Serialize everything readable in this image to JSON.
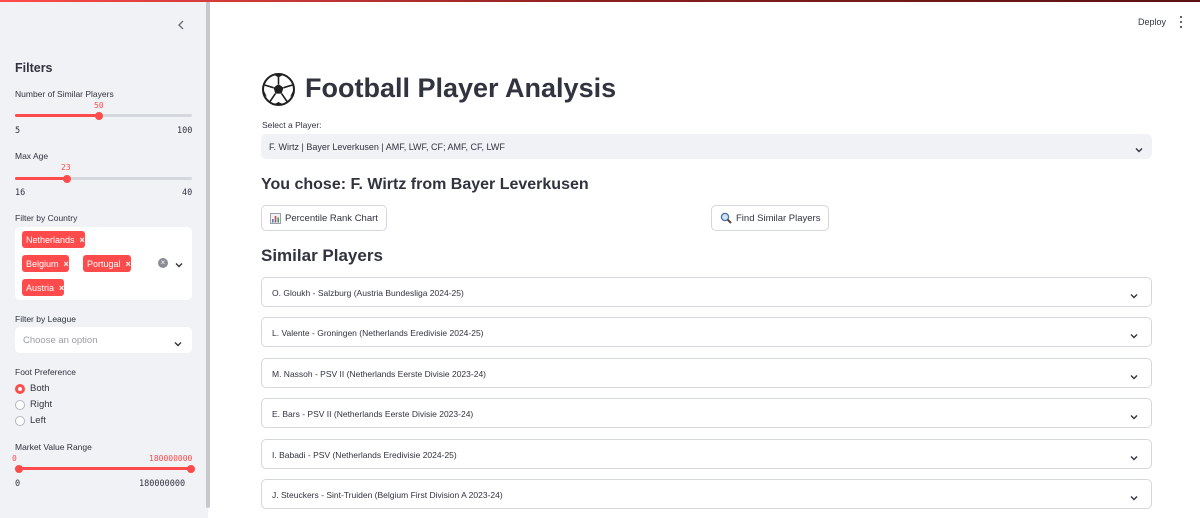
{
  "sidebar": {
    "heading": "Filters",
    "similar_players": {
      "label": "Number of Similar Players",
      "value": "50",
      "min": "5",
      "max": "100",
      "fraction": 0.4737
    },
    "max_age": {
      "label": "Max Age",
      "value": "23",
      "min": "16",
      "max": "40",
      "fraction": 0.2917
    },
    "country": {
      "label": "Filter by Country",
      "tags": [
        "Netherlands",
        "Belgium",
        "Portugal",
        "Austria"
      ]
    },
    "league": {
      "label": "Filter by League",
      "placeholder": "Choose an option"
    },
    "foot": {
      "label": "Foot Preference",
      "options": [
        "Both",
        "Right",
        "Left"
      ],
      "selected": "Both"
    },
    "market_value": {
      "label": "Market Value Range",
      "low": "0",
      "high": "180000000",
      "min": "0",
      "max": "180000000",
      "low_fraction": 0,
      "high_fraction": 1
    }
  },
  "header": {
    "deploy_label": "Deploy"
  },
  "main": {
    "title": "Football Player Analysis",
    "select_label": "Select a Player:",
    "selected_player": "F. Wirtz | Bayer Leverkusen | AMF, LWF, CF; AMF, CF, LWF",
    "chosen_text": "You chose: F. Wirtz from Bayer Leverkusen",
    "percentile_button": "Percentile Rank Chart",
    "find_button": "Find Similar Players",
    "similar_heading": "Similar Players",
    "similar_players": [
      "O. Gloukh - Salzburg (Austria Bundesliga 2024-25)",
      "L. Valente - Groningen (Netherlands Eredivisie 2024-25)",
      "M. Nassoh - PSV II (Netherlands Eerste Divisie 2023-24)",
      "E. Bars - PSV II (Netherlands Eerste Divisie 2023-24)",
      "I. Babadi - PSV (Netherlands Eredivisie 2024-25)",
      "J. Steuckers - Sint-Truiden (Belgium First Division A 2023-24)"
    ]
  },
  "colors": {
    "accent": "#ff4b4b",
    "sidebar_bg": "#f0f2f6",
    "text": "#31333f"
  }
}
